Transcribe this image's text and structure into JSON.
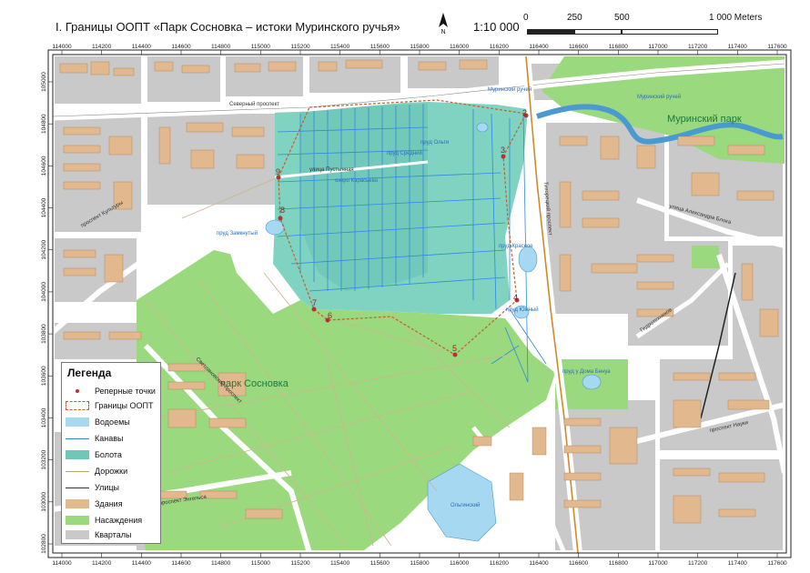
{
  "title": "I. Границы ООПТ «Парк Сосновка – истоки Муринского ручья»",
  "scale": "1:10 000",
  "scalebar": {
    "ticks": [
      "0",
      "250",
      "500",
      "1 000 Meters"
    ]
  },
  "colors": {
    "water": "#a7d8f2",
    "ditch": "#2f88e0",
    "bog": "#6fc7b8",
    "trail": "#c9b98c",
    "street": "#ffffff",
    "building": "#e2b88e",
    "green": "#9bd97f",
    "block": "#c9c9c9",
    "boundary": "#c0602c",
    "point": "#b33232"
  },
  "grid": {
    "x_top": [
      "114000",
      "114200",
      "114400",
      "114600",
      "114800",
      "115000",
      "115200",
      "115400",
      "115600",
      "115800",
      "116000",
      "116200",
      "116400",
      "116600",
      "116800",
      "117000",
      "117200",
      "117400",
      "117600"
    ],
    "x_bottom": [
      "114000",
      "114200",
      "114400",
      "114600",
      "114800",
      "115000",
      "115200",
      "115400",
      "115600",
      "115800",
      "116000",
      "116200",
      "116400",
      "116600",
      "116800",
      "117000",
      "117200",
      "117400",
      "117600"
    ],
    "y_left": [
      "105000",
      "104800",
      "104600",
      "104400",
      "104200",
      "104000",
      "103800",
      "103600",
      "103400",
      "103200",
      "103000",
      "102800"
    ]
  },
  "points": [
    {
      "label": "2"
    },
    {
      "label": "3"
    },
    {
      "label": "4"
    },
    {
      "label": "5"
    },
    {
      "label": "6"
    },
    {
      "label": "7"
    },
    {
      "label": "8"
    },
    {
      "label": "9"
    }
  ],
  "map_labels": {
    "murinsky_park": "Муринский парк",
    "sosnovka_park": "парк Сосновка",
    "severny_prospekt": "Северный проспект",
    "ulitsa_pustynnaya": "улица Пустынная",
    "tikhoretsky": "Тихорецкий проспект",
    "prud_sredny": "пруд Средний",
    "prud_olgi": "пруд Ольги",
    "prud_karasy": "озеро Карасьево",
    "prud_zamkny": "пруд Замкнутый",
    "prud_krasnoe": "пруд Красное",
    "prud_yuzhny": "пруд Южный",
    "prud_dom_binu": "пруд у Дома Бенуа",
    "olginsky": "Ольгинский",
    "murinsky_ruchey": "Муринский ручей",
    "murinsky_ruchey2": "Муринский ручей",
    "ulitsa_alex_blok": "улица Александра Блока",
    "kultury": "проспект Культуры",
    "svetlanovsky": "Светлановский проспект",
    "gidrotekh": "Гидротехников",
    "prospekt_nauki": "проспект Науки",
    "engelsa": "проспект Энгельса"
  },
  "legend": {
    "title": "Легенда",
    "items": [
      {
        "label": "Реперные точки"
      },
      {
        "label": "Границы ООПТ"
      },
      {
        "label": "Водоемы"
      },
      {
        "label": "Канавы"
      },
      {
        "label": "Болота"
      },
      {
        "label": "Дорожки"
      },
      {
        "label": "Улицы"
      },
      {
        "label": "Здания"
      },
      {
        "label": "Насаждения"
      },
      {
        "label": "Кварталы"
      }
    ]
  }
}
